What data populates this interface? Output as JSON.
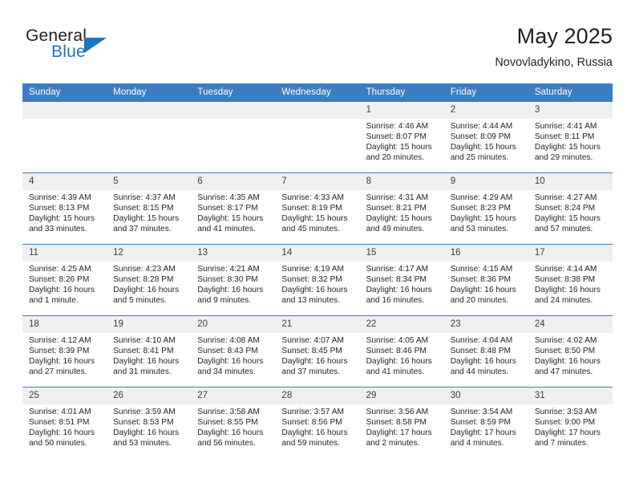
{
  "brand": {
    "name_part1": "General",
    "name_part2": "Blue"
  },
  "header": {
    "title": "May 2025",
    "subtitle": "Novovladykino, Russia"
  },
  "colors": {
    "header_blue": "#3b7dc4",
    "brand_blue": "#1b75bb",
    "daynum_bg": "#f0f0f0",
    "text": "#231f20"
  },
  "weekday_headers": [
    "Sunday",
    "Monday",
    "Tuesday",
    "Wednesday",
    "Thursday",
    "Friday",
    "Saturday"
  ],
  "weeks": [
    [
      {
        "day": "",
        "sunrise": "",
        "sunset": "",
        "daylight_line1": "",
        "daylight_line2": ""
      },
      {
        "day": "",
        "sunrise": "",
        "sunset": "",
        "daylight_line1": "",
        "daylight_line2": ""
      },
      {
        "day": "",
        "sunrise": "",
        "sunset": "",
        "daylight_line1": "",
        "daylight_line2": ""
      },
      {
        "day": "",
        "sunrise": "",
        "sunset": "",
        "daylight_line1": "",
        "daylight_line2": ""
      },
      {
        "day": "1",
        "sunrise": "Sunrise: 4:46 AM",
        "sunset": "Sunset: 8:07 PM",
        "daylight_line1": "Daylight: 15 hours",
        "daylight_line2": "and 20 minutes."
      },
      {
        "day": "2",
        "sunrise": "Sunrise: 4:44 AM",
        "sunset": "Sunset: 8:09 PM",
        "daylight_line1": "Daylight: 15 hours",
        "daylight_line2": "and 25 minutes."
      },
      {
        "day": "3",
        "sunrise": "Sunrise: 4:41 AM",
        "sunset": "Sunset: 8:11 PM",
        "daylight_line1": "Daylight: 15 hours",
        "daylight_line2": "and 29 minutes."
      }
    ],
    [
      {
        "day": "4",
        "sunrise": "Sunrise: 4:39 AM",
        "sunset": "Sunset: 8:13 PM",
        "daylight_line1": "Daylight: 15 hours",
        "daylight_line2": "and 33 minutes."
      },
      {
        "day": "5",
        "sunrise": "Sunrise: 4:37 AM",
        "sunset": "Sunset: 8:15 PM",
        "daylight_line1": "Daylight: 15 hours",
        "daylight_line2": "and 37 minutes."
      },
      {
        "day": "6",
        "sunrise": "Sunrise: 4:35 AM",
        "sunset": "Sunset: 8:17 PM",
        "daylight_line1": "Daylight: 15 hours",
        "daylight_line2": "and 41 minutes."
      },
      {
        "day": "7",
        "sunrise": "Sunrise: 4:33 AM",
        "sunset": "Sunset: 8:19 PM",
        "daylight_line1": "Daylight: 15 hours",
        "daylight_line2": "and 45 minutes."
      },
      {
        "day": "8",
        "sunrise": "Sunrise: 4:31 AM",
        "sunset": "Sunset: 8:21 PM",
        "daylight_line1": "Daylight: 15 hours",
        "daylight_line2": "and 49 minutes."
      },
      {
        "day": "9",
        "sunrise": "Sunrise: 4:29 AM",
        "sunset": "Sunset: 8:23 PM",
        "daylight_line1": "Daylight: 15 hours",
        "daylight_line2": "and 53 minutes."
      },
      {
        "day": "10",
        "sunrise": "Sunrise: 4:27 AM",
        "sunset": "Sunset: 8:24 PM",
        "daylight_line1": "Daylight: 15 hours",
        "daylight_line2": "and 57 minutes."
      }
    ],
    [
      {
        "day": "11",
        "sunrise": "Sunrise: 4:25 AM",
        "sunset": "Sunset: 8:26 PM",
        "daylight_line1": "Daylight: 16 hours",
        "daylight_line2": "and 1 minute."
      },
      {
        "day": "12",
        "sunrise": "Sunrise: 4:23 AM",
        "sunset": "Sunset: 8:28 PM",
        "daylight_line1": "Daylight: 16 hours",
        "daylight_line2": "and 5 minutes."
      },
      {
        "day": "13",
        "sunrise": "Sunrise: 4:21 AM",
        "sunset": "Sunset: 8:30 PM",
        "daylight_line1": "Daylight: 16 hours",
        "daylight_line2": "and 9 minutes."
      },
      {
        "day": "14",
        "sunrise": "Sunrise: 4:19 AM",
        "sunset": "Sunset: 8:32 PM",
        "daylight_line1": "Daylight: 16 hours",
        "daylight_line2": "and 13 minutes."
      },
      {
        "day": "15",
        "sunrise": "Sunrise: 4:17 AM",
        "sunset": "Sunset: 8:34 PM",
        "daylight_line1": "Daylight: 16 hours",
        "daylight_line2": "and 16 minutes."
      },
      {
        "day": "16",
        "sunrise": "Sunrise: 4:15 AM",
        "sunset": "Sunset: 8:36 PM",
        "daylight_line1": "Daylight: 16 hours",
        "daylight_line2": "and 20 minutes."
      },
      {
        "day": "17",
        "sunrise": "Sunrise: 4:14 AM",
        "sunset": "Sunset: 8:38 PM",
        "daylight_line1": "Daylight: 16 hours",
        "daylight_line2": "and 24 minutes."
      }
    ],
    [
      {
        "day": "18",
        "sunrise": "Sunrise: 4:12 AM",
        "sunset": "Sunset: 8:39 PM",
        "daylight_line1": "Daylight: 16 hours",
        "daylight_line2": "and 27 minutes."
      },
      {
        "day": "19",
        "sunrise": "Sunrise: 4:10 AM",
        "sunset": "Sunset: 8:41 PM",
        "daylight_line1": "Daylight: 16 hours",
        "daylight_line2": "and 31 minutes."
      },
      {
        "day": "20",
        "sunrise": "Sunrise: 4:08 AM",
        "sunset": "Sunset: 8:43 PM",
        "daylight_line1": "Daylight: 16 hours",
        "daylight_line2": "and 34 minutes."
      },
      {
        "day": "21",
        "sunrise": "Sunrise: 4:07 AM",
        "sunset": "Sunset: 8:45 PM",
        "daylight_line1": "Daylight: 16 hours",
        "daylight_line2": "and 37 minutes."
      },
      {
        "day": "22",
        "sunrise": "Sunrise: 4:05 AM",
        "sunset": "Sunset: 8:46 PM",
        "daylight_line1": "Daylight: 16 hours",
        "daylight_line2": "and 41 minutes."
      },
      {
        "day": "23",
        "sunrise": "Sunrise: 4:04 AM",
        "sunset": "Sunset: 8:48 PM",
        "daylight_line1": "Daylight: 16 hours",
        "daylight_line2": "and 44 minutes."
      },
      {
        "day": "24",
        "sunrise": "Sunrise: 4:02 AM",
        "sunset": "Sunset: 8:50 PM",
        "daylight_line1": "Daylight: 16 hours",
        "daylight_line2": "and 47 minutes."
      }
    ],
    [
      {
        "day": "25",
        "sunrise": "Sunrise: 4:01 AM",
        "sunset": "Sunset: 8:51 PM",
        "daylight_line1": "Daylight: 16 hours",
        "daylight_line2": "and 50 minutes."
      },
      {
        "day": "26",
        "sunrise": "Sunrise: 3:59 AM",
        "sunset": "Sunset: 8:53 PM",
        "daylight_line1": "Daylight: 16 hours",
        "daylight_line2": "and 53 minutes."
      },
      {
        "day": "27",
        "sunrise": "Sunrise: 3:58 AM",
        "sunset": "Sunset: 8:55 PM",
        "daylight_line1": "Daylight: 16 hours",
        "daylight_line2": "and 56 minutes."
      },
      {
        "day": "28",
        "sunrise": "Sunrise: 3:57 AM",
        "sunset": "Sunset: 8:56 PM",
        "daylight_line1": "Daylight: 16 hours",
        "daylight_line2": "and 59 minutes."
      },
      {
        "day": "29",
        "sunrise": "Sunrise: 3:56 AM",
        "sunset": "Sunset: 8:58 PM",
        "daylight_line1": "Daylight: 17 hours",
        "daylight_line2": "and 2 minutes."
      },
      {
        "day": "30",
        "sunrise": "Sunrise: 3:54 AM",
        "sunset": "Sunset: 8:59 PM",
        "daylight_line1": "Daylight: 17 hours",
        "daylight_line2": "and 4 minutes."
      },
      {
        "day": "31",
        "sunrise": "Sunrise: 3:53 AM",
        "sunset": "Sunset: 9:00 PM",
        "daylight_line1": "Daylight: 17 hours",
        "daylight_line2": "and 7 minutes."
      }
    ]
  ]
}
